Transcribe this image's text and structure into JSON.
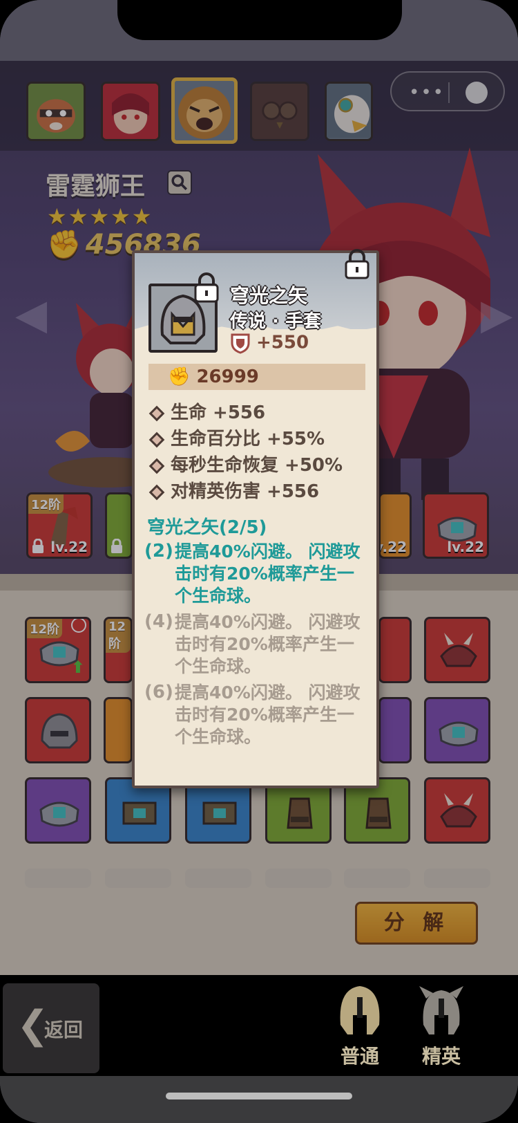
{
  "heroes": [
    {
      "name": "raccoon",
      "color": "#c8552a",
      "selected": false
    },
    {
      "name": "fox-girl",
      "color": "#c02a36",
      "selected": false
    },
    {
      "name": "thunder-lion-king",
      "color": "#c89a3a",
      "selected": true
    },
    {
      "name": "owl",
      "color": "#5a3a2c",
      "selected": false
    },
    {
      "name": "eagle",
      "color": "#6a7a8a",
      "selected": false
    }
  ],
  "hero": {
    "name": "雷霆狮王",
    "stars": "★★★★★",
    "star_count": 5,
    "power": "456836"
  },
  "row_lv": [
    "lv.22",
    "lv.22",
    "lv.22"
  ],
  "badges": {
    "tier": "12阶"
  },
  "popup": {
    "name": "穹光之矢",
    "type": "传说 · 手套",
    "defense": "+550",
    "power": "26999",
    "stats": [
      "生命 +556",
      "生命百分比 +55%",
      "每秒生命恢复 +50%",
      "对精英伤害 +556"
    ],
    "set_title": "穹光之矢(2/5)",
    "set_bonuses": [
      {
        "count": "(2)",
        "text": "提高40%闪避。 闪避攻击时有20%概率产生一个生命球。",
        "active": true
      },
      {
        "count": "(4)",
        "text": "提高40%闪避。 闪避攻击时有20%概率产生一个生命球。",
        "active": false
      },
      {
        "count": "(6)",
        "text": "提高40%闪避。 闪避攻击时有20%概率产生一个生命球。",
        "active": false
      }
    ]
  },
  "buttons": {
    "decompose": "分 解",
    "back": "返回",
    "normal": "普通",
    "elite": "精英"
  },
  "colors": {
    "accent_teal": "#1e9a98",
    "gold": "#e2b23a"
  }
}
